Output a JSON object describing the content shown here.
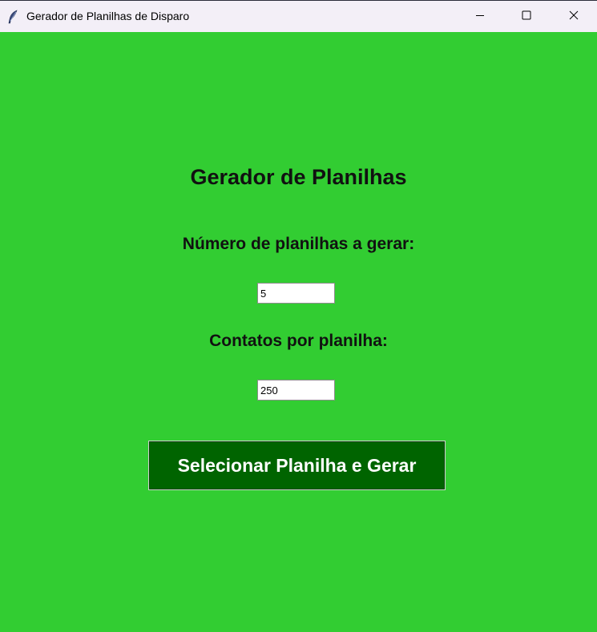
{
  "window": {
    "title": "Gerador de Planilhas de Disparo",
    "icon": "feather-icon",
    "controls": [
      "minimize-icon",
      "maximize-icon",
      "close-icon"
    ]
  },
  "form": {
    "heading": "Gerador de Planilhas",
    "sheets_label": "Número de planilhas a gerar:",
    "sheets_value": "5",
    "contacts_label": "Contatos por planilha:",
    "contacts_value": "250",
    "submit_label": "Selecionar Planilha e Gerar"
  },
  "colors": {
    "background": "#32cd32",
    "button": "#006400",
    "button_text": "#ffffff"
  }
}
